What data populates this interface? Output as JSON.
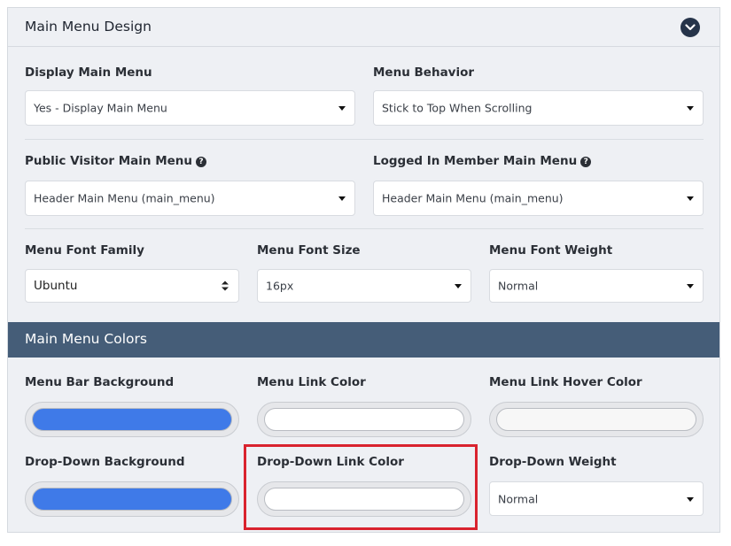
{
  "design": {
    "title": "Main Menu Design",
    "display_main_menu": {
      "label": "Display Main Menu",
      "value": "Yes - Display Main Menu"
    },
    "menu_behavior": {
      "label": "Menu Behavior",
      "value": "Stick to Top When Scrolling"
    },
    "public_menu": {
      "label": "Public Visitor Main Menu",
      "value": "Header Main Menu (main_menu)"
    },
    "member_menu": {
      "label": "Logged In Member Main Menu",
      "value": "Header Main Menu (main_menu)"
    },
    "font_family": {
      "label": "Menu Font Family",
      "value": "Ubuntu"
    },
    "font_size": {
      "label": "Menu Font Size",
      "value": "16px"
    },
    "font_weight": {
      "label": "Menu Font Weight",
      "value": "Normal"
    }
  },
  "colors": {
    "title": "Main Menu Colors",
    "bar_background": {
      "label": "Menu Bar Background",
      "color": "#3f7ae8"
    },
    "link_color": {
      "label": "Menu Link Color",
      "color": "#ffffff"
    },
    "link_hover_color": {
      "label": "Menu Link Hover Color",
      "color": "#f7f7f7"
    },
    "dropdown_background": {
      "label": "Drop-Down Background",
      "color": "#3f7ae8"
    },
    "dropdown_link_color": {
      "label": "Drop-Down Link Color",
      "color": "#ffffff"
    },
    "dropdown_weight": {
      "label": "Drop-Down Weight",
      "value": "Normal"
    }
  },
  "theme": {
    "header_bar": "#455d78",
    "highlight": "#d9232e"
  }
}
